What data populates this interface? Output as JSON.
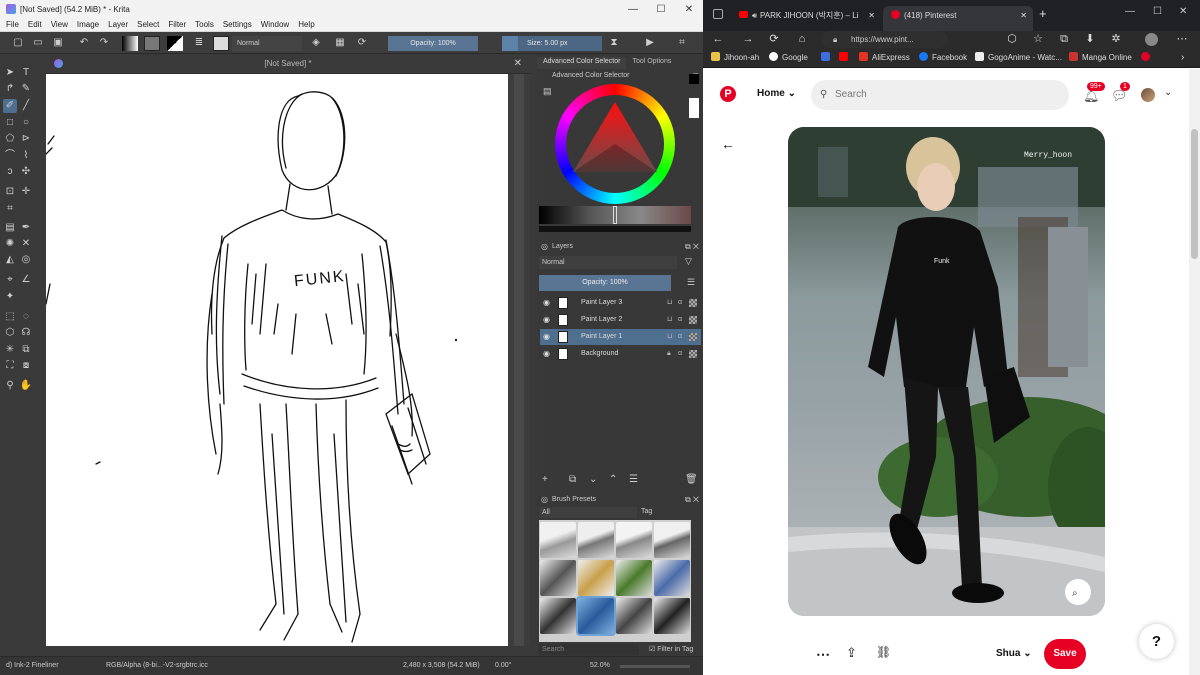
{
  "krita": {
    "title": "[Not Saved]  (54.2 MiB)  * - Krita",
    "menu": [
      "File",
      "Edit",
      "View",
      "Image",
      "Layer",
      "Select",
      "Filter",
      "Tools",
      "Settings",
      "Window",
      "Help"
    ],
    "toolbar": {
      "blend_mode": "Normal",
      "opacity": "Opacity: 100%",
      "size": "Size: 5.00 px"
    },
    "document_tab": "[Not Saved]  *",
    "sketch_text": "FUNK",
    "dock_tabs": [
      "Advanced Color Selector",
      "Tool Options"
    ],
    "color_selector_title": "Advanced Color Selector",
    "layers": {
      "title": "Layers",
      "blend_mode": "Normal",
      "opacity": "Opacity:  100%",
      "items": [
        {
          "name": "Paint Layer 3"
        },
        {
          "name": "Paint Layer 2"
        },
        {
          "name": "Paint Layer 1"
        },
        {
          "name": "Background"
        }
      ]
    },
    "brush_presets": {
      "title": "Brush Presets",
      "filter": "All",
      "tag": "Tag",
      "search_placeholder": "Search",
      "filter_in_tag": "Filter in Tag"
    },
    "status": {
      "brush": "d) Ink-2 Fineliner",
      "colorspace": "RGB/Alpha (8-bi...-V2-srgbtrc.icc",
      "dimensions": "2,480 x 3,508 (54.2 MiB)",
      "rotation": "0.00°",
      "zoom": "52.0%"
    }
  },
  "browser": {
    "tabs": [
      {
        "title": "PARK JIHOON (박지훈) – Li"
      },
      {
        "title": "(418) Pinterest"
      }
    ],
    "url": "https://www.pint...",
    "bookmarks": [
      "Jihoon-ah",
      "Google",
      "",
      "",
      "AliExpress",
      "Facebook",
      "GogoAnime - Watc...",
      "Manga Online"
    ],
    "pinterest": {
      "home_label": "Home",
      "search_placeholder": "Search",
      "notifications_badge": "99+",
      "messages_badge": "1",
      "watermark": "Merry_hoon",
      "shirt_text": "Funk",
      "board": "Shua",
      "save_label": "Save",
      "help_label": "?"
    }
  },
  "colors": {
    "krita_bg": "#3a3a3a",
    "krita_accent": "#4f6f8f",
    "pinterest_red": "#e60023"
  }
}
